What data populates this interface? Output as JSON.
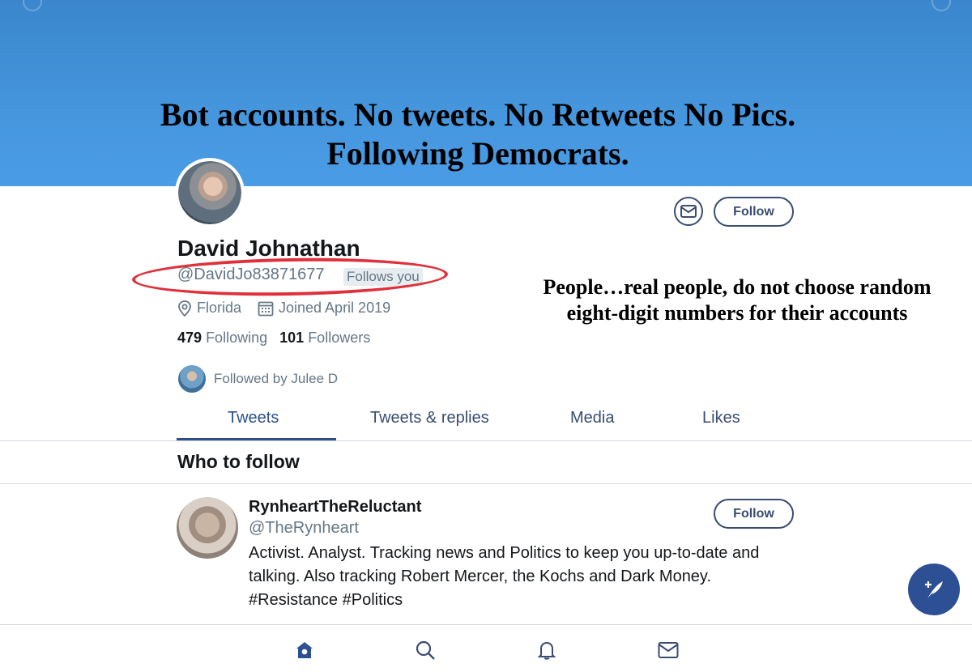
{
  "overlay": {
    "title_line1": "Bot accounts. No tweets. No Retweets No Pics.",
    "title_line2": "Following Democrats.",
    "note_line1": "People…real people, do not choose random",
    "note_line2": "eight-digit numbers for their accounts",
    "highlight_color": "#e0303b"
  },
  "profile": {
    "name": "David Johnathan",
    "handle": "@DavidJo83871677",
    "follows_you": "Follows you",
    "location": "Florida",
    "joined": "Joined April 2019",
    "following_count": "479",
    "following_label": "Following",
    "followers_count": "101",
    "followers_label": "Followers",
    "followed_by": "Followed by Julee D",
    "follow_button": "Follow",
    "message_icon": "mail-icon"
  },
  "tabs": [
    {
      "label": "Tweets",
      "active": true
    },
    {
      "label": "Tweets & replies",
      "active": false
    },
    {
      "label": "Media",
      "active": false
    },
    {
      "label": "Likes",
      "active": false
    }
  ],
  "who_to_follow": {
    "heading": "Who to follow",
    "suggestion": {
      "name": "RynheartTheReluctant",
      "handle": "@TheRynheart",
      "bio": "Activist. Analyst. Tracking news and Politics to keep you up-to-date and talking. Also tracking Robert Mercer, the Kochs and Dark Money. #Resistance #Politics",
      "follow_button": "Follow"
    }
  },
  "bottom_nav": [
    "home-icon",
    "search-icon",
    "notifications-icon",
    "messages-icon"
  ],
  "colors": {
    "banner": "#4596dd",
    "accent": "#2d4f93",
    "muted_text": "#657786"
  }
}
